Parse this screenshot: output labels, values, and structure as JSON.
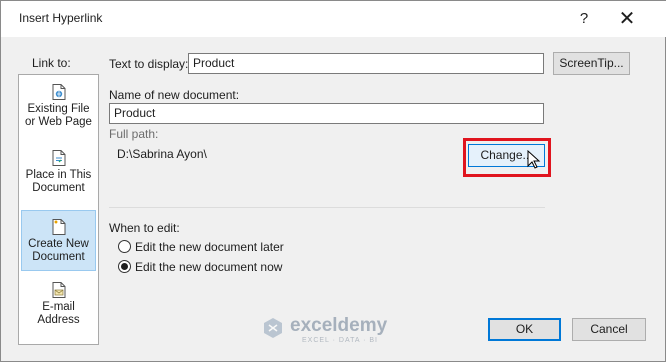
{
  "dialog": {
    "title": "Insert Hyperlink",
    "help_glyph": "?",
    "close_glyph": "✕"
  },
  "link_to": {
    "label": "Link to:",
    "items": [
      {
        "line1": "Existing File",
        "line2": "or Web Page",
        "icon": "web-page-icon"
      },
      {
        "line1": "Place in This",
        "line2": "Document",
        "icon": "place-in-document-icon"
      },
      {
        "line1": "Create New",
        "line2": "Document",
        "icon": "new-document-icon",
        "selected": true
      },
      {
        "line1": "E-mail",
        "line2": "Address",
        "icon": "email-address-icon"
      }
    ]
  },
  "text_to_display": {
    "label": "Text to display:",
    "value": "Product",
    "screentip_label": "ScreenTip..."
  },
  "new_document": {
    "name_label": "Name of new document:",
    "name_value": "Product",
    "full_path_label": "Full path:",
    "full_path_value": "D:\\Sabrina Ayon\\",
    "change_label": "Change..."
  },
  "when_to_edit": {
    "label": "When to edit:",
    "options": [
      {
        "label": "Edit the new document later",
        "selected": false
      },
      {
        "label": "Edit the new document now",
        "selected": true
      }
    ]
  },
  "footer": {
    "ok_label": "OK",
    "cancel_label": "Cancel"
  },
  "watermark": {
    "name": "exceldemy",
    "tagline": "EXCEL · DATA · BI"
  },
  "colors": {
    "highlight_box": "#e0141e",
    "selected_item_bg": "#cce4f7",
    "default_button_border": "#0078d7"
  }
}
